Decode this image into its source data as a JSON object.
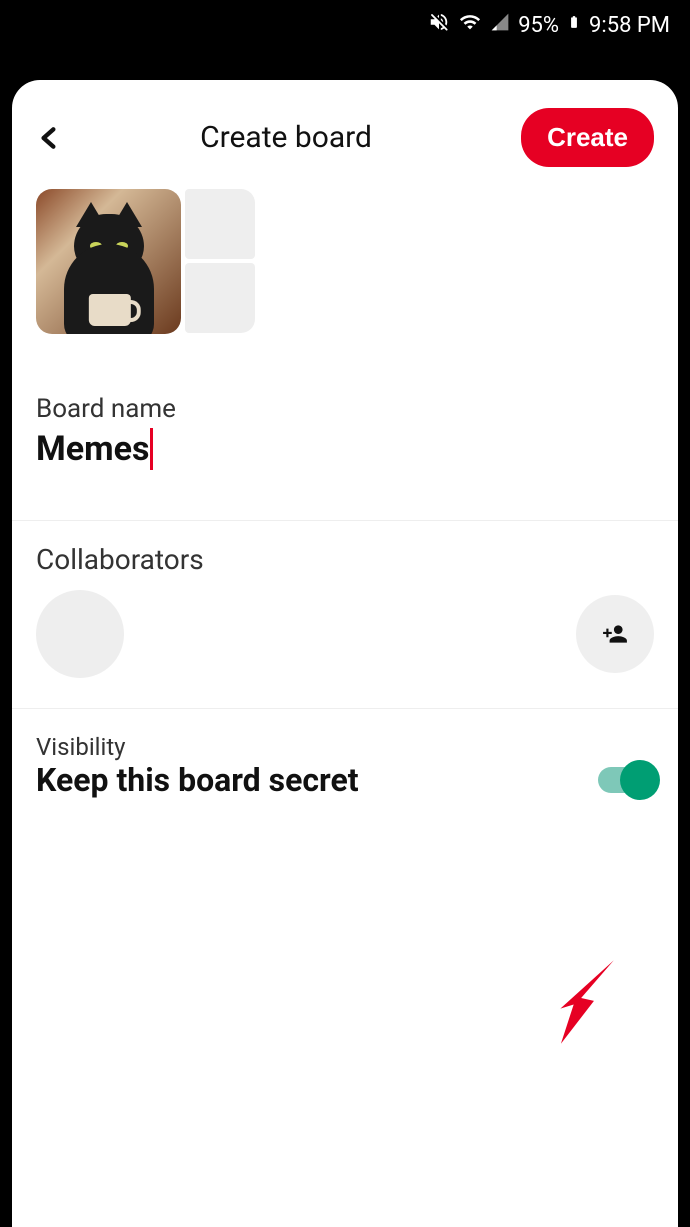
{
  "status_bar": {
    "battery_percent": "95%",
    "time": "9:58 PM"
  },
  "header": {
    "title": "Create board",
    "create_button": "Create"
  },
  "board_name": {
    "label": "Board name",
    "value": "Memes"
  },
  "collaborators": {
    "label": "Collaborators"
  },
  "visibility": {
    "label": "Visibility",
    "secret_label": "Keep this board secret",
    "secret_enabled": true
  }
}
